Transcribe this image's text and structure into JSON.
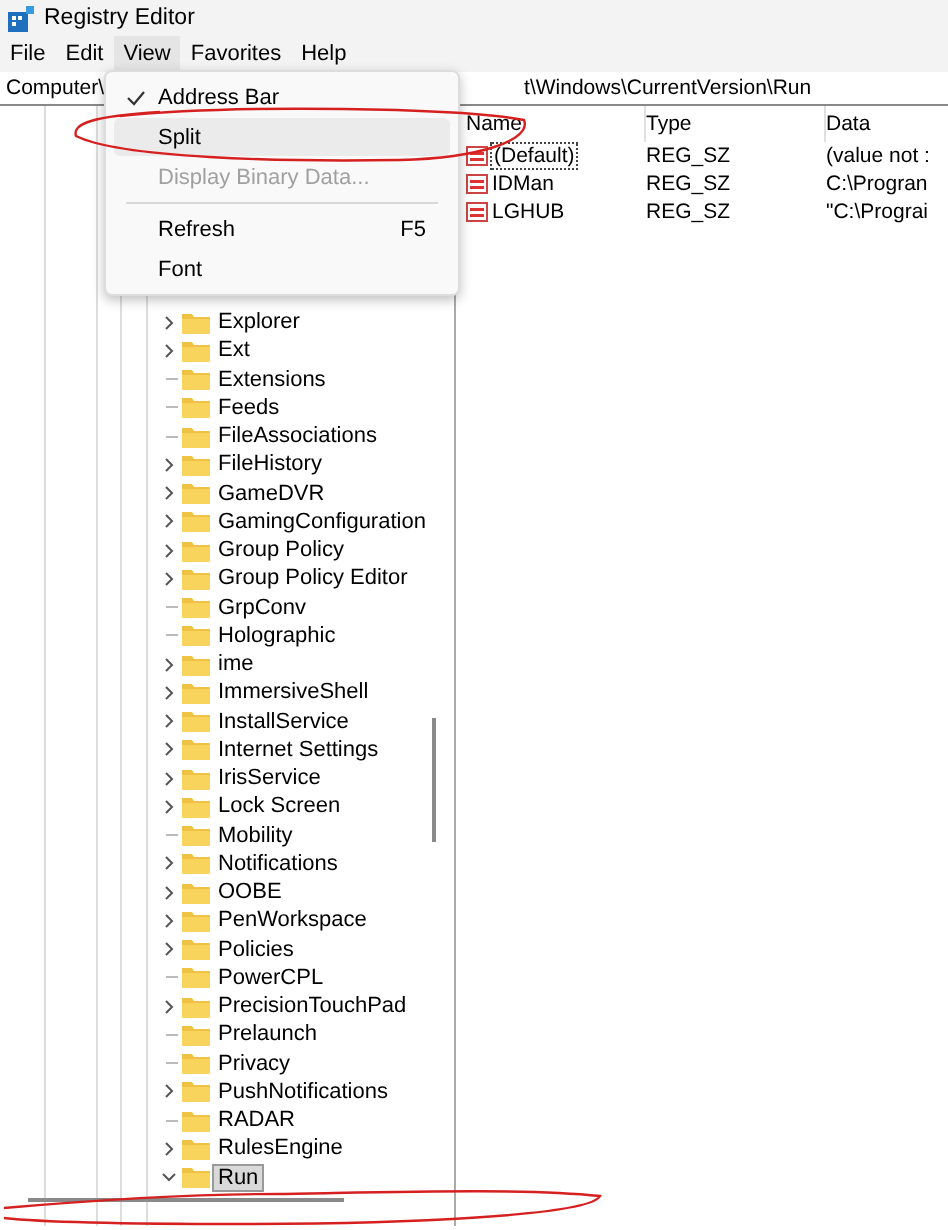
{
  "window": {
    "title": "Registry Editor"
  },
  "menu_bar": [
    {
      "label": "File",
      "selected": false
    },
    {
      "label": "Edit",
      "selected": false
    },
    {
      "label": "View",
      "selected": true
    },
    {
      "label": "Favorites",
      "selected": false
    },
    {
      "label": "Help",
      "selected": false
    }
  ],
  "address_bar": {
    "left_text": "Computer\\",
    "right_text": "t\\Windows\\CurrentVersion\\Run"
  },
  "view_menu": [
    {
      "kind": "item",
      "label": "Address Bar",
      "checked": true,
      "selected": false,
      "disabled": false
    },
    {
      "kind": "item",
      "label": "Split",
      "checked": false,
      "selected": true,
      "disabled": false
    },
    {
      "kind": "item",
      "label": "Display Binary Data...",
      "checked": false,
      "selected": false,
      "disabled": true
    },
    {
      "kind": "separator"
    },
    {
      "kind": "item",
      "label": "Refresh",
      "shortcut": "F5",
      "checked": false,
      "selected": false,
      "disabled": false
    },
    {
      "kind": "item",
      "label": "Font",
      "checked": false,
      "selected": false,
      "disabled": false
    }
  ],
  "tree": [
    {
      "label": "Explorer",
      "kind": "collapsed",
      "selected": false
    },
    {
      "label": "Ext",
      "kind": "collapsed",
      "selected": false
    },
    {
      "label": "Extensions",
      "kind": "leaf",
      "selected": false
    },
    {
      "label": "Feeds",
      "kind": "leaf",
      "selected": false
    },
    {
      "label": "FileAssociations",
      "kind": "leaf",
      "selected": false
    },
    {
      "label": "FileHistory",
      "kind": "collapsed",
      "selected": false
    },
    {
      "label": "GameDVR",
      "kind": "collapsed",
      "selected": false
    },
    {
      "label": "GamingConfiguration",
      "kind": "collapsed",
      "selected": false
    },
    {
      "label": "Group Policy",
      "kind": "collapsed",
      "selected": false
    },
    {
      "label": "Group Policy Editor",
      "kind": "collapsed",
      "selected": false
    },
    {
      "label": "GrpConv",
      "kind": "leaf",
      "selected": false
    },
    {
      "label": "Holographic",
      "kind": "leaf",
      "selected": false
    },
    {
      "label": "ime",
      "kind": "collapsed",
      "selected": false
    },
    {
      "label": "ImmersiveShell",
      "kind": "collapsed",
      "selected": false
    },
    {
      "label": "InstallService",
      "kind": "collapsed",
      "selected": false
    },
    {
      "label": "Internet Settings",
      "kind": "collapsed",
      "selected": false
    },
    {
      "label": "IrisService",
      "kind": "collapsed",
      "selected": false
    },
    {
      "label": "Lock Screen",
      "kind": "collapsed",
      "selected": false
    },
    {
      "label": "Mobility",
      "kind": "leaf",
      "selected": false
    },
    {
      "label": "Notifications",
      "kind": "collapsed",
      "selected": false
    },
    {
      "label": "OOBE",
      "kind": "collapsed",
      "selected": false
    },
    {
      "label": "PenWorkspace",
      "kind": "collapsed",
      "selected": false
    },
    {
      "label": "Policies",
      "kind": "collapsed",
      "selected": false
    },
    {
      "label": "PowerCPL",
      "kind": "leaf",
      "selected": false
    },
    {
      "label": "PrecisionTouchPad",
      "kind": "collapsed",
      "selected": false
    },
    {
      "label": "Prelaunch",
      "kind": "leaf",
      "selected": false
    },
    {
      "label": "Privacy",
      "kind": "leaf",
      "selected": false
    },
    {
      "label": "PushNotifications",
      "kind": "collapsed",
      "selected": false
    },
    {
      "label": "RADAR",
      "kind": "leaf",
      "selected": false
    },
    {
      "label": "RulesEngine",
      "kind": "collapsed",
      "selected": false
    },
    {
      "label": "Run",
      "kind": "expanded",
      "selected": true
    }
  ],
  "values_table": {
    "columns": [
      "Name",
      "Type",
      "Data"
    ],
    "rows": [
      {
        "name": "(Default)",
        "type": "REG_SZ",
        "data": "(value not :",
        "selected": true
      },
      {
        "name": "IDMan",
        "type": "REG_SZ",
        "data": "C:\\Progran",
        "selected": false
      },
      {
        "name": "LGHUB",
        "type": "REG_SZ",
        "data": "\"C:\\Prograi",
        "selected": false
      }
    ]
  }
}
